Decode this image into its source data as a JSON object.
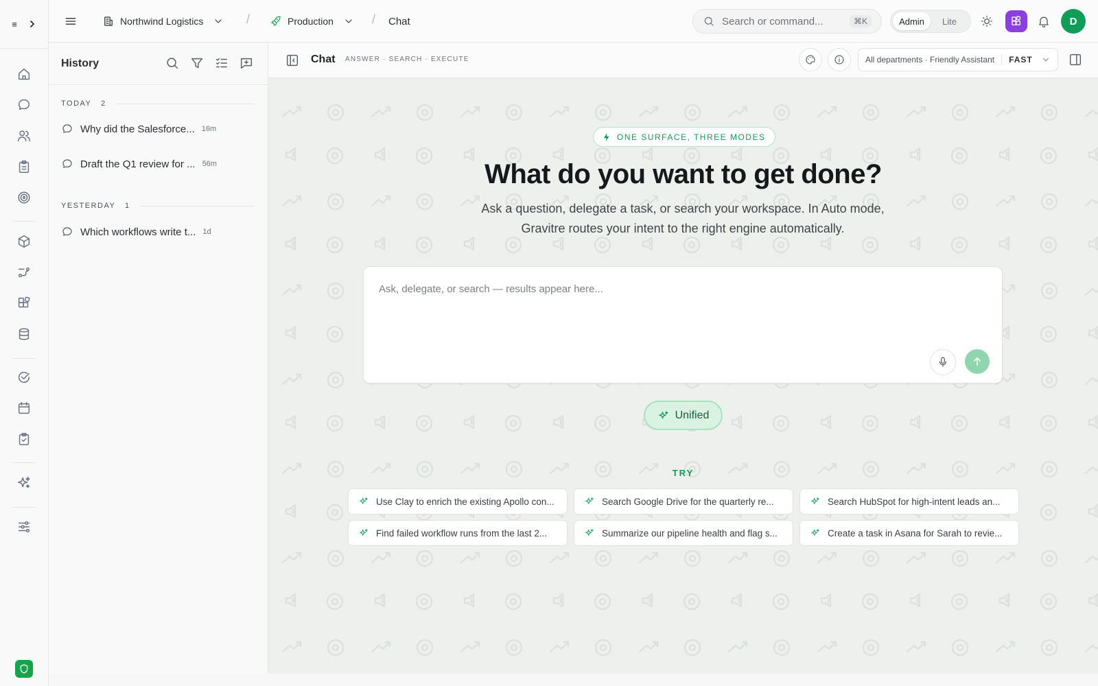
{
  "rail": {
    "brand_mark": "≡",
    "items": [
      "home-icon",
      "chat-icon",
      "users-icon",
      "clipboard-icon",
      "target-icon",
      "box-icon",
      "workflow-icon",
      "apps-icon",
      "database-icon",
      "check-circle-icon",
      "calendar-icon",
      "clipboard-check-icon",
      "sparkles-icon",
      "sliders-icon"
    ]
  },
  "topbar": {
    "workspace": "Northwind Logistics",
    "environment": "Production",
    "page": "Chat",
    "search_placeholder": "Search or command...",
    "search_shortcut": "⌘K",
    "mode_admin": "Admin",
    "mode_lite": "Lite",
    "avatar_initial": "D"
  },
  "history": {
    "title": "History",
    "groups": [
      {
        "label": "TODAY",
        "count": "2",
        "items": [
          {
            "title": "Why did the Salesforce...",
            "age": "16m"
          },
          {
            "title": "Draft the Q1 review for ...",
            "age": "56m"
          }
        ]
      },
      {
        "label": "YESTERDAY",
        "count": "1",
        "items": [
          {
            "title": "Which workflows write t...",
            "age": "1d"
          }
        ]
      }
    ]
  },
  "chat": {
    "title": "Chat",
    "modes": "ANSWER · SEARCH · EXECUTE",
    "scope_text": "All departments · Friendly Assistant",
    "speed": "FAST",
    "pill": "ONE SURFACE, THREE MODES",
    "headline": "What do you want to get done?",
    "subline": "Ask a question, delegate a task, or search your workspace. In Auto mode, Gravitre routes your intent to the right engine automatically.",
    "composer_placeholder": "Ask, delegate, or search — results appear here...",
    "mode_chip": "Unified",
    "try_label": "TRY",
    "suggestions": [
      "Use Clay to enrich the existing Apollo con...",
      "Search Google Drive for the quarterly re...",
      "Search HubSpot for high-intent leads an...",
      "Find failed workflow runs from the last 2...",
      "Summarize our pipeline health and flag s...",
      "Create a task in Asana for Sarah to revie..."
    ]
  },
  "colors": {
    "accent_green": "#119955",
    "send_button": "#8fd6ae",
    "apps_purple": "#8b3fe0",
    "avatar_green": "#0f9d58"
  }
}
